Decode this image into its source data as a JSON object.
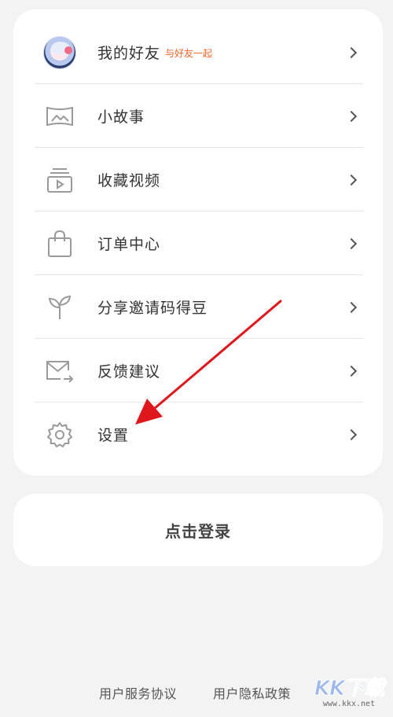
{
  "menu": {
    "items": [
      {
        "label": "我的好友",
        "sublabel": "与好友一起",
        "icon": "avatar"
      },
      {
        "label": "小故事",
        "icon": "picture-icon"
      },
      {
        "label": "收藏视频",
        "icon": "video-collection-icon"
      },
      {
        "label": "订单中心",
        "icon": "shopping-bag-icon"
      },
      {
        "label": "分享邀请码得豆",
        "icon": "sprout-icon"
      },
      {
        "label": "反馈建议",
        "icon": "mail-forward-icon"
      },
      {
        "label": "设置",
        "icon": "gear-icon"
      }
    ]
  },
  "login": {
    "label": "点击登录"
  },
  "footer": {
    "terms_label": "用户服务协议",
    "privacy_label": "用户隐私政策"
  },
  "watermark": {
    "logo": "KK下载",
    "url": "www.kkx.net"
  },
  "colors": {
    "background": "#f3f3f3",
    "card": "#ffffff",
    "accent_orange": "#f0642b",
    "annotation_red": "#e0161d",
    "icon_gray": "#9a9a9a"
  }
}
